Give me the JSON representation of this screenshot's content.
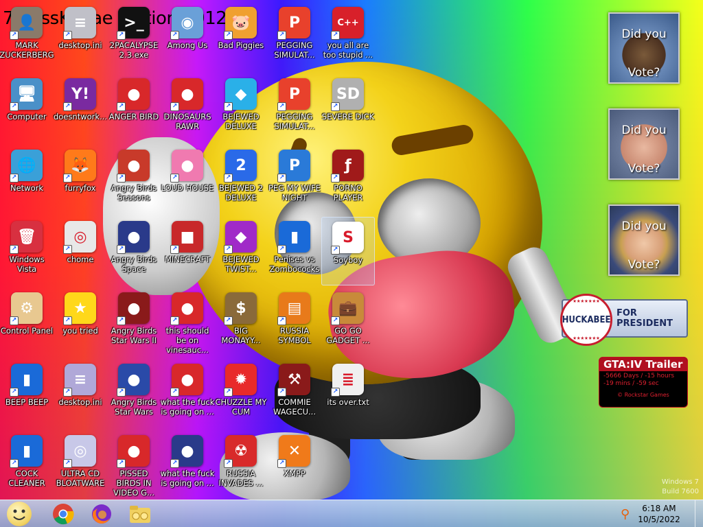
{
  "desktop": {
    "top_text": "7 RossKahae Edition 2012",
    "icons": [
      {
        "label": "MARK ZUCKERBERG",
        "icon": "person-icon",
        "color": "#8a7a6a",
        "glyph": "👤"
      },
      {
        "label": "desktop.ini",
        "icon": "settings-file-icon",
        "color": "#c0c0c8",
        "glyph": "≡"
      },
      {
        "label": "2PACALYPSE 2.3.exe",
        "icon": "terminal-icon",
        "color": "#111111",
        "glyph": ">_"
      },
      {
        "label": "Among Us",
        "icon": "among-us-icon",
        "color": "#6aa0d8",
        "glyph": "◉"
      },
      {
        "label": "Bad Piggies",
        "icon": "bad-piggies-icon",
        "color": "#f0a030",
        "glyph": "🐷"
      },
      {
        "label": "PEGGING SIMULAT...",
        "icon": "p-logo-icon",
        "color": "#e8412c",
        "glyph": "P"
      },
      {
        "label": "you all are too stupid ...",
        "icon": "devcpp-icon",
        "color": "#d8202a",
        "glyph": "C++"
      },
      {
        "label": "Computer",
        "icon": "computer-icon",
        "color": "#4a90c8",
        "glyph": "🖥"
      },
      {
        "label": "doesntwork...",
        "icon": "yahoo-messenger-icon",
        "color": "#7a2aa0",
        "glyph": "Y!"
      },
      {
        "label": "ANGER BIRD",
        "icon": "angry-bird-icon",
        "color": "#d8282a",
        "glyph": "●"
      },
      {
        "label": "DINOSAURS RAWR",
        "icon": "angry-bird-icon",
        "color": "#d8282a",
        "glyph": "●"
      },
      {
        "label": "BEJEWED DELUXE",
        "icon": "gem-icon",
        "color": "#2ab0e8",
        "glyph": "◆"
      },
      {
        "label": "PEGGING SIMULAT...",
        "icon": "p-logo-icon",
        "color": "#e8412c",
        "glyph": "P"
      },
      {
        "label": "SEVERE DICK",
        "icon": "sd-gear-icon",
        "color": "#b0b0b0",
        "glyph": "SD"
      },
      {
        "label": "Network",
        "icon": "network-icon",
        "color": "#3aa0d8",
        "glyph": "🌐"
      },
      {
        "label": "furryfox",
        "icon": "firefox-icon",
        "color": "#ff7a1a",
        "glyph": "🦊"
      },
      {
        "label": "Angry Birds Seasons",
        "icon": "angry-birds-seasons-icon",
        "color": "#c83a2a",
        "glyph": "●"
      },
      {
        "label": "LOUD HOUSE",
        "icon": "angry-bird-pink-icon",
        "color": "#f07ab0",
        "glyph": "●"
      },
      {
        "label": "BEJEWED 2 DELUXE",
        "icon": "gem-2-icon",
        "color": "#2a6ae8",
        "glyph": "2"
      },
      {
        "label": "PEG MY WIFE NIGHT",
        "icon": "p-logo-icon",
        "color": "#2a7ad8",
        "glyph": "P"
      },
      {
        "label": "PORNO PLAYER",
        "icon": "flash-icon",
        "color": "#a01a1a",
        "glyph": "ƒ"
      },
      {
        "label": "Windows Vista",
        "icon": "recycle-bin-icon",
        "color": "#d83040",
        "glyph": "🗑"
      },
      {
        "label": "chome",
        "icon": "chrome-icon",
        "color": "#e8e8e8",
        "glyph": "◎"
      },
      {
        "label": "Angry Birds Space",
        "icon": "angry-birds-space-icon",
        "color": "#2a3a8a",
        "glyph": "●"
      },
      {
        "label": "MINECRAFT",
        "icon": "angry-bird-block-icon",
        "color": "#c8282a",
        "glyph": "■"
      },
      {
        "label": "BEJEWED TWIST...",
        "icon": "gem-twist-icon",
        "color": "#a02ac8",
        "glyph": "◆"
      },
      {
        "label": "Penises vs Zombococks",
        "icon": "blue-file-icon",
        "color": "#1a6ad8",
        "glyph": "▮"
      },
      {
        "label": "Soyboy",
        "icon": "s-logo-icon",
        "color": "#ffffff",
        "glyph": "S"
      },
      {
        "label": "Control Panel",
        "icon": "control-panel-icon",
        "color": "#e8c890",
        "glyph": "⚙"
      },
      {
        "label": "you tried",
        "icon": "star-icon",
        "color": "#ffd81a",
        "glyph": "★"
      },
      {
        "label": "Angry Birds Star Wars II",
        "icon": "star-wars-bird-icon",
        "color": "#8a1a1a",
        "glyph": "●"
      },
      {
        "label": "this should be on vinesauc...",
        "icon": "angry-bird-icon",
        "color": "#d8282a",
        "glyph": "●"
      },
      {
        "label": "BIG MONAYY...",
        "icon": "money-bag-icon",
        "color": "#8a6a3a",
        "glyph": "$"
      },
      {
        "label": "RUSSIA SYMBOL",
        "icon": "orange-block-icon",
        "color": "#e87a1a",
        "glyph": "▤"
      },
      {
        "label": "GO GO GADGET ...",
        "icon": "briefcase-icon",
        "color": "#c88a3a",
        "glyph": "💼"
      },
      {
        "label": "BEEP BEEP",
        "icon": "blue-file-icon",
        "color": "#1a6ad8",
        "glyph": "▮"
      },
      {
        "label": "desktop.ini",
        "icon": "settings-file-icon",
        "color": "#b0a8d8",
        "glyph": "≡"
      },
      {
        "label": "Angry Birds Star Wars",
        "icon": "star-wars-bird-icon",
        "color": "#2a4aa8",
        "glyph": "●"
      },
      {
        "label": "what the fuck is going on ...",
        "icon": "angry-bird-icon",
        "color": "#d8282a",
        "glyph": "●"
      },
      {
        "label": "CHUZZLE MY CUM",
        "icon": "chuzzle-icon",
        "color": "#e82a2a",
        "glyph": "✹"
      },
      {
        "label": "COMMIE WAGECU...",
        "icon": "papers-please-icon",
        "color": "#8a1a1a",
        "glyph": "⚒"
      },
      {
        "label": "its over.txt",
        "icon": "text-file-icon",
        "color": "#f0f0f0",
        "glyph": "≣"
      },
      {
        "label": "COCK CLEANER",
        "icon": "blue-file-icon",
        "color": "#1a6ad8",
        "glyph": "▮"
      },
      {
        "label": "ULTRA CD BLOATWARE",
        "icon": "cd-icon",
        "color": "#c8c8e8",
        "glyph": "◎"
      },
      {
        "label": "PISSED BIRDS IN VIDEO G...",
        "icon": "angry-bird-icon",
        "color": "#d8282a",
        "glyph": "●"
      },
      {
        "label": "what the fuck is going on ...",
        "icon": "angry-birds-space-icon",
        "color": "#2a3a8a",
        "glyph": "●"
      },
      {
        "label": "RUSSIA INVADES ...",
        "icon": "radiation-icon",
        "color": "#d82a2a",
        "glyph": "☢"
      },
      {
        "label": "XMPP",
        "icon": "xampp-icon",
        "color": "#f07a1a",
        "glyph": "✕"
      }
    ],
    "selected_label": "Soyboy"
  },
  "gadgets": {
    "vote_line1": "Did you",
    "vote_line2": "Vote?",
    "huckabee_badge": "HUCKABEE",
    "huckabee_label": "FOR PRESIDENT",
    "gta_title": "GTA:IV Trailer",
    "gta_line1": "-5666 Days / -15 hours",
    "gta_line2": "-19 mins / -59 sec",
    "gta_footer": "© Rockstar Games"
  },
  "watermark": {
    "line1": "Windows 7",
    "line2": "Build 7600"
  },
  "taskbar": {
    "time": "6:18 AM",
    "date": "10/5/2022"
  }
}
